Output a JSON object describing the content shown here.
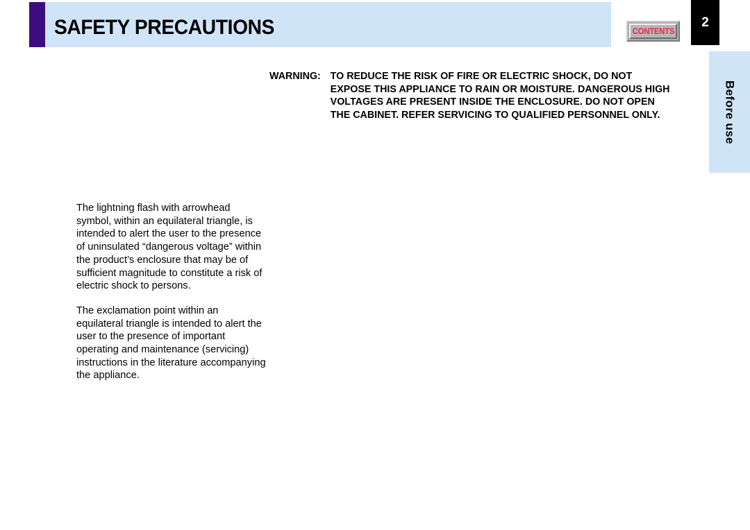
{
  "header": {
    "title": "SAFETY PRECAUTIONS",
    "accent_color": "#3D0D80",
    "band_color": "#CFE4F7",
    "contents_button_label": "CONTENTS",
    "contents_button_color": "#E8284A",
    "page_number": "2"
  },
  "side_tab": {
    "label": "Before use",
    "color": "#CFE4F7"
  },
  "warning": {
    "label": "WARNING:",
    "lines": [
      "TO REDUCE THE RISK OF FIRE OR ELECTRIC SHOCK, DO NOT",
      "EXPOSE THIS APPLIANCE TO RAIN OR MOISTURE. DANGEROUS HIGH",
      "VOLTAGES ARE PRESENT INSIDE THE ENCLOSURE. DO NOT OPEN",
      "THE CABINET. REFER SERVICING TO QUALIFIED PERSONNEL ONLY."
    ]
  },
  "body": {
    "paragraphs": [
      "The lightning flash with arrowhead symbol, within an equilateral triangle, is intended to alert the user to the presence of uninsulated “dangerous voltage” within the product’s enclosure that may be of sufficient magnitude to constitute a risk of electric shock to persons.",
      "The exclamation point within an equilateral triangle is intended to alert the user to the presence of important operating and maintenance (servicing) instructions in the literature accompanying the appliance."
    ]
  }
}
